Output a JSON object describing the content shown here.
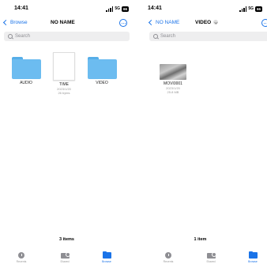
{
  "left": {
    "status": {
      "time": "14:41",
      "network": "5G",
      "battery": "66"
    },
    "nav": {
      "back_label": "Browse",
      "title": "NO NAME"
    },
    "search": {
      "placeholder": "Search"
    },
    "items": [
      {
        "name": "AUDIO",
        "kind": "folder"
      },
      {
        "name": "TIME",
        "kind": "file",
        "date": "2023/1/20",
        "size": "26 bytes"
      },
      {
        "name": "VIDEO",
        "kind": "folder"
      }
    ],
    "count": "3 items",
    "tabs": [
      {
        "label": "Recents",
        "icon": "clock-icon"
      },
      {
        "label": "Shared",
        "icon": "shared-folder-icon"
      },
      {
        "label": "Browse",
        "icon": "folder-icon",
        "active": true
      }
    ]
  },
  "right": {
    "status": {
      "time": "14:41",
      "network": "5G",
      "battery": "66"
    },
    "nav": {
      "back_label": "NO NAME",
      "title": "VIDEO"
    },
    "search": {
      "placeholder": "Search"
    },
    "items": [
      {
        "name": "MOVI0001",
        "kind": "video",
        "date": "2023/1/20",
        "size": "25.8 MB"
      }
    ],
    "count": "1 item",
    "tabs": [
      {
        "label": "Recents",
        "icon": "clock-icon"
      },
      {
        "label": "Shared",
        "icon": "shared-folder-icon"
      },
      {
        "label": "Browse",
        "icon": "folder-icon",
        "active": true
      }
    ]
  },
  "colors": {
    "accent": "#1a73e8",
    "folder": "#6cbcf0"
  }
}
